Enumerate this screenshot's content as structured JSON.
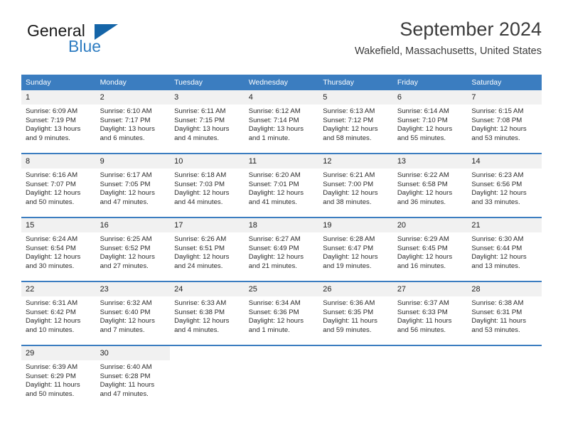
{
  "brand": {
    "name_top": "General",
    "name_bottom": "Blue",
    "triangle_color": "#1565a8",
    "blue_color": "#2f7dc2"
  },
  "header": {
    "title": "September 2024",
    "subtitle": "Wakefield, Massachusetts, United States"
  },
  "theme": {
    "header_blue": "#3b7dc0",
    "daynum_band": "#f1f1f1",
    "text": "#2b2b2b"
  },
  "weekday_headers": [
    "Sunday",
    "Monday",
    "Tuesday",
    "Wednesday",
    "Thursday",
    "Friday",
    "Saturday"
  ],
  "weeks": [
    [
      {
        "day": "1",
        "sunrise": "Sunrise: 6:09 AM",
        "sunset": "Sunset: 7:19 PM",
        "daylight_line1": "Daylight: 13 hours",
        "daylight_line2": "and 9 minutes."
      },
      {
        "day": "2",
        "sunrise": "Sunrise: 6:10 AM",
        "sunset": "Sunset: 7:17 PM",
        "daylight_line1": "Daylight: 13 hours",
        "daylight_line2": "and 6 minutes."
      },
      {
        "day": "3",
        "sunrise": "Sunrise: 6:11 AM",
        "sunset": "Sunset: 7:15 PM",
        "daylight_line1": "Daylight: 13 hours",
        "daylight_line2": "and 4 minutes."
      },
      {
        "day": "4",
        "sunrise": "Sunrise: 6:12 AM",
        "sunset": "Sunset: 7:14 PM",
        "daylight_line1": "Daylight: 13 hours",
        "daylight_line2": "and 1 minute."
      },
      {
        "day": "5",
        "sunrise": "Sunrise: 6:13 AM",
        "sunset": "Sunset: 7:12 PM",
        "daylight_line1": "Daylight: 12 hours",
        "daylight_line2": "and 58 minutes."
      },
      {
        "day": "6",
        "sunrise": "Sunrise: 6:14 AM",
        "sunset": "Sunset: 7:10 PM",
        "daylight_line1": "Daylight: 12 hours",
        "daylight_line2": "and 55 minutes."
      },
      {
        "day": "7",
        "sunrise": "Sunrise: 6:15 AM",
        "sunset": "Sunset: 7:08 PM",
        "daylight_line1": "Daylight: 12 hours",
        "daylight_line2": "and 53 minutes."
      }
    ],
    [
      {
        "day": "8",
        "sunrise": "Sunrise: 6:16 AM",
        "sunset": "Sunset: 7:07 PM",
        "daylight_line1": "Daylight: 12 hours",
        "daylight_line2": "and 50 minutes."
      },
      {
        "day": "9",
        "sunrise": "Sunrise: 6:17 AM",
        "sunset": "Sunset: 7:05 PM",
        "daylight_line1": "Daylight: 12 hours",
        "daylight_line2": "and 47 minutes."
      },
      {
        "day": "10",
        "sunrise": "Sunrise: 6:18 AM",
        "sunset": "Sunset: 7:03 PM",
        "daylight_line1": "Daylight: 12 hours",
        "daylight_line2": "and 44 minutes."
      },
      {
        "day": "11",
        "sunrise": "Sunrise: 6:20 AM",
        "sunset": "Sunset: 7:01 PM",
        "daylight_line1": "Daylight: 12 hours",
        "daylight_line2": "and 41 minutes."
      },
      {
        "day": "12",
        "sunrise": "Sunrise: 6:21 AM",
        "sunset": "Sunset: 7:00 PM",
        "daylight_line1": "Daylight: 12 hours",
        "daylight_line2": "and 38 minutes."
      },
      {
        "day": "13",
        "sunrise": "Sunrise: 6:22 AM",
        "sunset": "Sunset: 6:58 PM",
        "daylight_line1": "Daylight: 12 hours",
        "daylight_line2": "and 36 minutes."
      },
      {
        "day": "14",
        "sunrise": "Sunrise: 6:23 AM",
        "sunset": "Sunset: 6:56 PM",
        "daylight_line1": "Daylight: 12 hours",
        "daylight_line2": "and 33 minutes."
      }
    ],
    [
      {
        "day": "15",
        "sunrise": "Sunrise: 6:24 AM",
        "sunset": "Sunset: 6:54 PM",
        "daylight_line1": "Daylight: 12 hours",
        "daylight_line2": "and 30 minutes."
      },
      {
        "day": "16",
        "sunrise": "Sunrise: 6:25 AM",
        "sunset": "Sunset: 6:52 PM",
        "daylight_line1": "Daylight: 12 hours",
        "daylight_line2": "and 27 minutes."
      },
      {
        "day": "17",
        "sunrise": "Sunrise: 6:26 AM",
        "sunset": "Sunset: 6:51 PM",
        "daylight_line1": "Daylight: 12 hours",
        "daylight_line2": "and 24 minutes."
      },
      {
        "day": "18",
        "sunrise": "Sunrise: 6:27 AM",
        "sunset": "Sunset: 6:49 PM",
        "daylight_line1": "Daylight: 12 hours",
        "daylight_line2": "and 21 minutes."
      },
      {
        "day": "19",
        "sunrise": "Sunrise: 6:28 AM",
        "sunset": "Sunset: 6:47 PM",
        "daylight_line1": "Daylight: 12 hours",
        "daylight_line2": "and 19 minutes."
      },
      {
        "day": "20",
        "sunrise": "Sunrise: 6:29 AM",
        "sunset": "Sunset: 6:45 PM",
        "daylight_line1": "Daylight: 12 hours",
        "daylight_line2": "and 16 minutes."
      },
      {
        "day": "21",
        "sunrise": "Sunrise: 6:30 AM",
        "sunset": "Sunset: 6:44 PM",
        "daylight_line1": "Daylight: 12 hours",
        "daylight_line2": "and 13 minutes."
      }
    ],
    [
      {
        "day": "22",
        "sunrise": "Sunrise: 6:31 AM",
        "sunset": "Sunset: 6:42 PM",
        "daylight_line1": "Daylight: 12 hours",
        "daylight_line2": "and 10 minutes."
      },
      {
        "day": "23",
        "sunrise": "Sunrise: 6:32 AM",
        "sunset": "Sunset: 6:40 PM",
        "daylight_line1": "Daylight: 12 hours",
        "daylight_line2": "and 7 minutes."
      },
      {
        "day": "24",
        "sunrise": "Sunrise: 6:33 AM",
        "sunset": "Sunset: 6:38 PM",
        "daylight_line1": "Daylight: 12 hours",
        "daylight_line2": "and 4 minutes."
      },
      {
        "day": "25",
        "sunrise": "Sunrise: 6:34 AM",
        "sunset": "Sunset: 6:36 PM",
        "daylight_line1": "Daylight: 12 hours",
        "daylight_line2": "and 1 minute."
      },
      {
        "day": "26",
        "sunrise": "Sunrise: 6:36 AM",
        "sunset": "Sunset: 6:35 PM",
        "daylight_line1": "Daylight: 11 hours",
        "daylight_line2": "and 59 minutes."
      },
      {
        "day": "27",
        "sunrise": "Sunrise: 6:37 AM",
        "sunset": "Sunset: 6:33 PM",
        "daylight_line1": "Daylight: 11 hours",
        "daylight_line2": "and 56 minutes."
      },
      {
        "day": "28",
        "sunrise": "Sunrise: 6:38 AM",
        "sunset": "Sunset: 6:31 PM",
        "daylight_line1": "Daylight: 11 hours",
        "daylight_line2": "and 53 minutes."
      }
    ],
    [
      {
        "day": "29",
        "sunrise": "Sunrise: 6:39 AM",
        "sunset": "Sunset: 6:29 PM",
        "daylight_line1": "Daylight: 11 hours",
        "daylight_line2": "and 50 minutes."
      },
      {
        "day": "30",
        "sunrise": "Sunrise: 6:40 AM",
        "sunset": "Sunset: 6:28 PM",
        "daylight_line1": "Daylight: 11 hours",
        "daylight_line2": "and 47 minutes."
      },
      {
        "day": "",
        "sunrise": "",
        "sunset": "",
        "daylight_line1": "",
        "daylight_line2": ""
      },
      {
        "day": "",
        "sunrise": "",
        "sunset": "",
        "daylight_line1": "",
        "daylight_line2": ""
      },
      {
        "day": "",
        "sunrise": "",
        "sunset": "",
        "daylight_line1": "",
        "daylight_line2": ""
      },
      {
        "day": "",
        "sunrise": "",
        "sunset": "",
        "daylight_line1": "",
        "daylight_line2": ""
      },
      {
        "day": "",
        "sunrise": "",
        "sunset": "",
        "daylight_line1": "",
        "daylight_line2": ""
      }
    ]
  ]
}
